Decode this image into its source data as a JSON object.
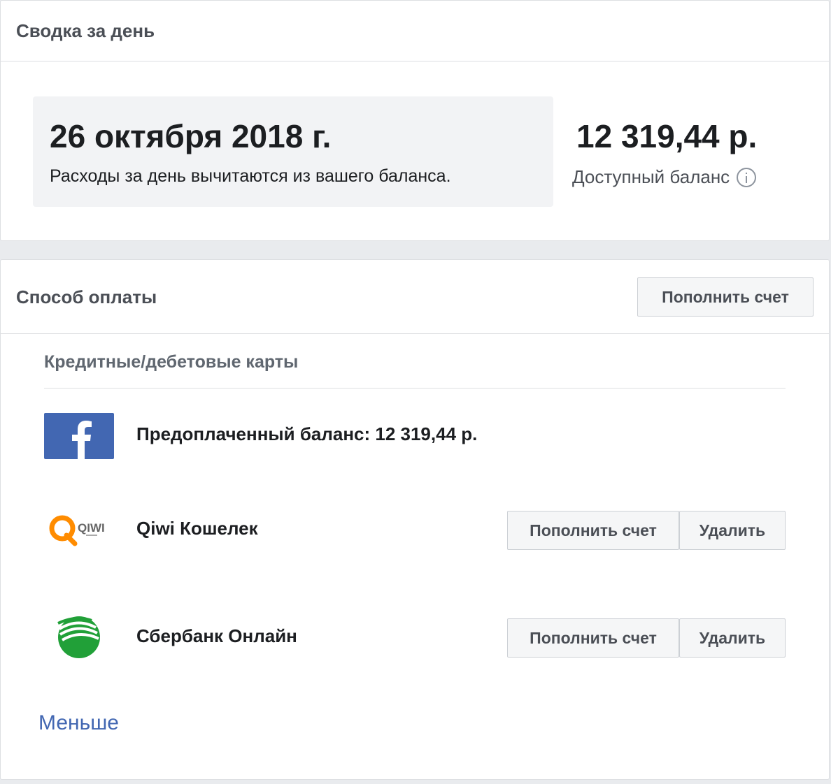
{
  "summary": {
    "title": "Сводка за день",
    "date": "26 октября 2018 г.",
    "description": "Расходы за день вычитаются из вашего баланса.",
    "balance_amount": "12 319,44 р.",
    "balance_label": "Доступный баланс"
  },
  "payment": {
    "title": "Способ оплаты",
    "topup_label": "Пополнить счет",
    "section_title": "Кредитные/дебетовые карты",
    "methods": [
      {
        "name": "Предоплаченный баланс: 12 319,44 р.",
        "icon": "facebook-icon"
      },
      {
        "name": "Qiwi Кошелек",
        "icon": "qiwi-icon",
        "topup_label": "Пополнить счет",
        "delete_label": "Удалить"
      },
      {
        "name": "Сбербанк Онлайн",
        "icon": "sberbank-icon",
        "topup_label": "Пополнить счет",
        "delete_label": "Удалить"
      }
    ],
    "less_link": "Меньше"
  },
  "colors": {
    "page_background": "#e9ebee",
    "facebook_blue": "#4267b2",
    "qiwi_orange": "#ff8c00",
    "sberbank_green": "#21a038",
    "link": "#4267b2"
  }
}
